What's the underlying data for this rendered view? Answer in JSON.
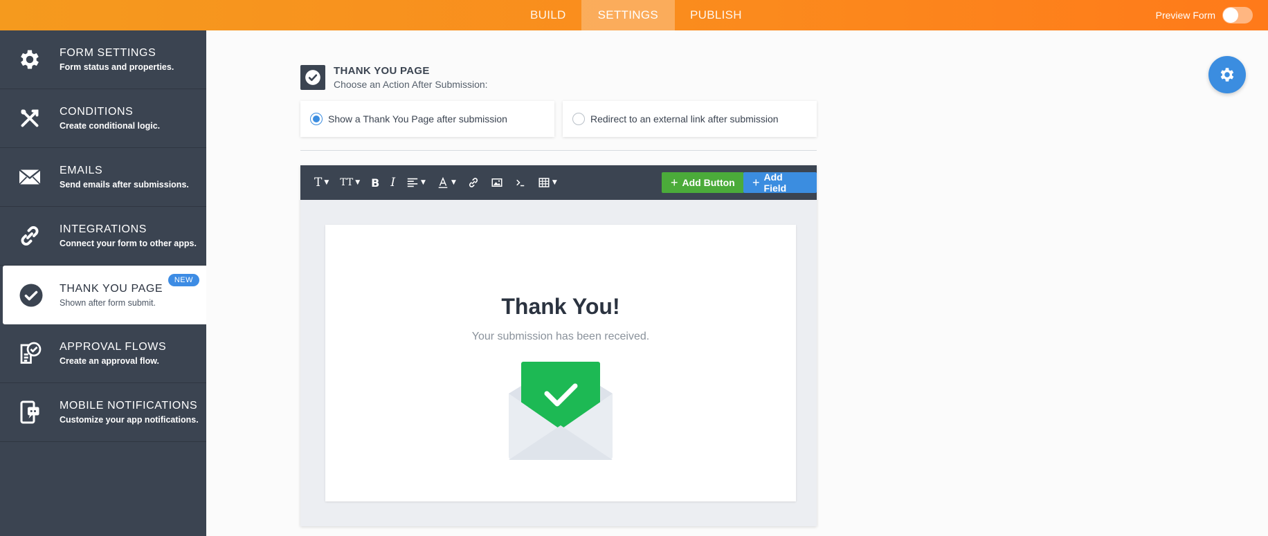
{
  "topnav": {
    "tabs": [
      {
        "label": "BUILD"
      },
      {
        "label": "SETTINGS"
      },
      {
        "label": "PUBLISH"
      }
    ],
    "preview_label": "Preview Form"
  },
  "sidebar": {
    "items": [
      {
        "title": "FORM SETTINGS",
        "subtitle": "Form status and properties.",
        "icon": "gear-icon"
      },
      {
        "title": "CONDITIONS",
        "subtitle": "Create conditional logic.",
        "icon": "conditions-icon"
      },
      {
        "title": "EMAILS",
        "subtitle": "Send emails after submissions.",
        "icon": "envelope-icon"
      },
      {
        "title": "INTEGRATIONS",
        "subtitle": "Connect your form to other apps.",
        "icon": "link-icon"
      },
      {
        "title": "THANK YOU PAGE",
        "subtitle": "Shown after form submit.",
        "icon": "checkmark-circle-icon",
        "badge": "NEW"
      },
      {
        "title": "APPROVAL FLOWS",
        "subtitle": "Create an approval flow.",
        "icon": "approval-icon"
      },
      {
        "title": "MOBILE NOTIFICATIONS",
        "subtitle": "Customize your app notifications.",
        "icon": "mobile-notification-icon"
      }
    ]
  },
  "page": {
    "title": "THANK YOU PAGE",
    "subtitle": "Choose an Action After Submission:"
  },
  "options": {
    "show_thank_you": "Show a Thank You Page after submission",
    "redirect": "Redirect to an external link after submission"
  },
  "toolbar": {
    "add_button": "Add Button",
    "add_field": "Add Field",
    "bold": "B",
    "italic": "I",
    "font": "T",
    "font_size": "TT"
  },
  "preview": {
    "title": "Thank You!",
    "message": "Your submission has been received."
  },
  "colors": {
    "accent": "#3b8de0",
    "sidebar": "#3b4451",
    "topbar": "#fb8a1d",
    "green": "#4bab3a",
    "envelope_green": "#1db954"
  }
}
